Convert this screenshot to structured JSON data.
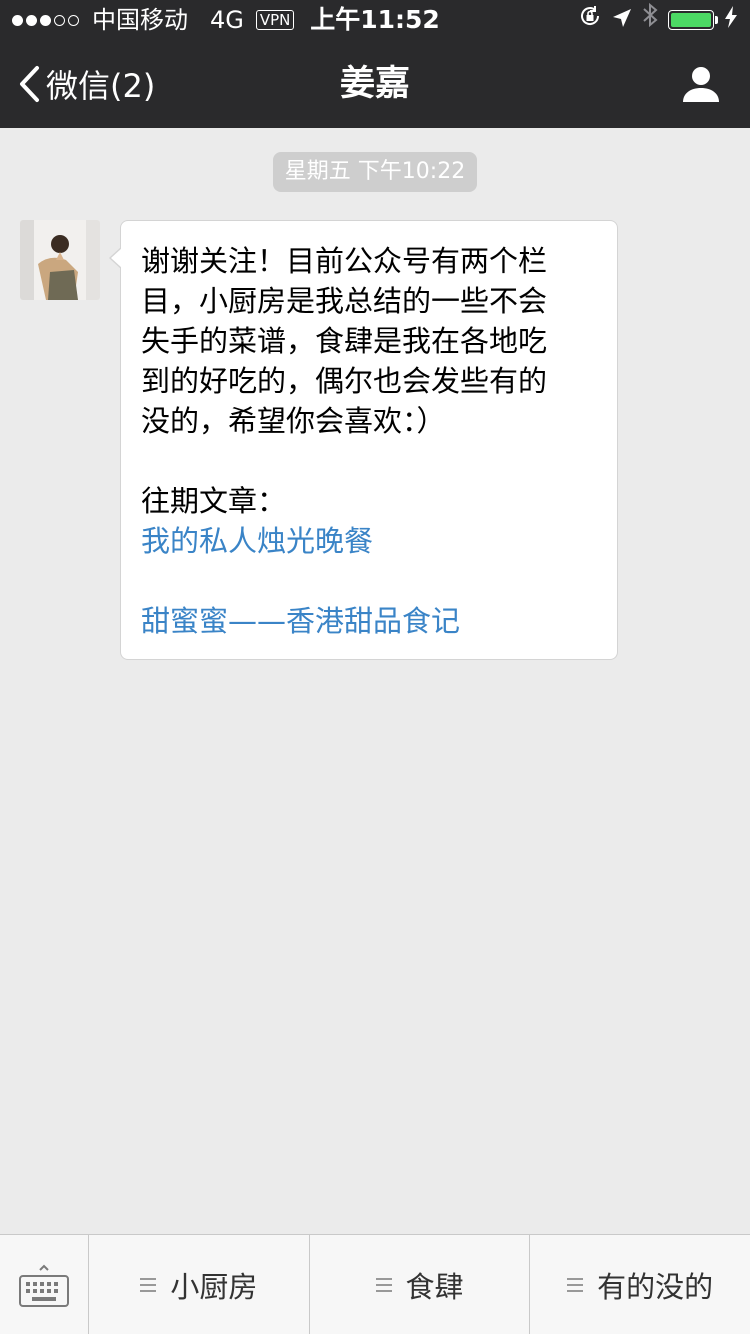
{
  "status_bar": {
    "carrier": "中国移动",
    "network": "4G",
    "vpn": "VPN",
    "time": "上午11:52"
  },
  "nav": {
    "back_label": "微信(2)",
    "title": "姜嘉"
  },
  "chat": {
    "timestamp": "星期五 下午10:22",
    "message": {
      "text": "谢谢关注！目前公众号有两个栏\n目，小厨房是我总结的一些不会\n失手的菜谱，食肆是我在各地吃\n到的好吃的，偶尔也会发些有的\n没的，希望你会喜欢：）",
      "past_label": "往期文章：",
      "links": [
        "我的私人烛光晚餐",
        "甜蜜蜜——香港甜品食记"
      ]
    }
  },
  "menu": {
    "items": [
      "小厨房",
      "食肆",
      "有的没的"
    ]
  },
  "colors": {
    "nav_bg": "#2a2a2c",
    "chat_bg": "#ebebeb",
    "link": "#3a84c7",
    "battery": "#4cd964"
  },
  "icons": [
    "back-chevron-icon",
    "profile-icon",
    "keyboard-icon",
    "menu-list-icon",
    "lock-rotation-icon",
    "location-arrow-icon",
    "bluetooth-icon",
    "battery-icon",
    "charging-bolt-icon"
  ]
}
